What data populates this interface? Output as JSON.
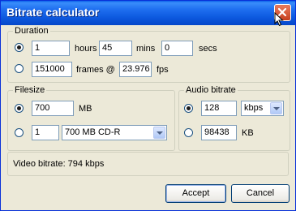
{
  "window": {
    "title": "Bitrate calculator"
  },
  "duration": {
    "legend": "Duration",
    "hours_value": "1",
    "hours_label": "hours",
    "mins_value": "45",
    "mins_label": "mins",
    "secs_value": "0",
    "secs_label": "secs",
    "frames_value": "151000",
    "frames_label": "frames @",
    "fps_value": "23.976",
    "fps_label": "fps",
    "time_radio_selected": true
  },
  "filesize": {
    "legend": "Filesize",
    "mb_value": "700",
    "mb_label": "MB",
    "count_value": "1",
    "media_option": "700 MB CD-R",
    "mb_radio_selected": true
  },
  "audio": {
    "legend": "Audio bitrate",
    "bitrate_value": "128",
    "unit_option": "kbps",
    "kb_value": "98438",
    "kb_label": "KB",
    "bitrate_radio_selected": true
  },
  "result": {
    "text": "Video bitrate: 794 kbps"
  },
  "buttons": {
    "accept": "Accept",
    "cancel": "Cancel"
  },
  "icons": {
    "close": "close-icon",
    "cursor": "mouse-cursor-icon",
    "dropdown": "chevron-down-icon"
  }
}
